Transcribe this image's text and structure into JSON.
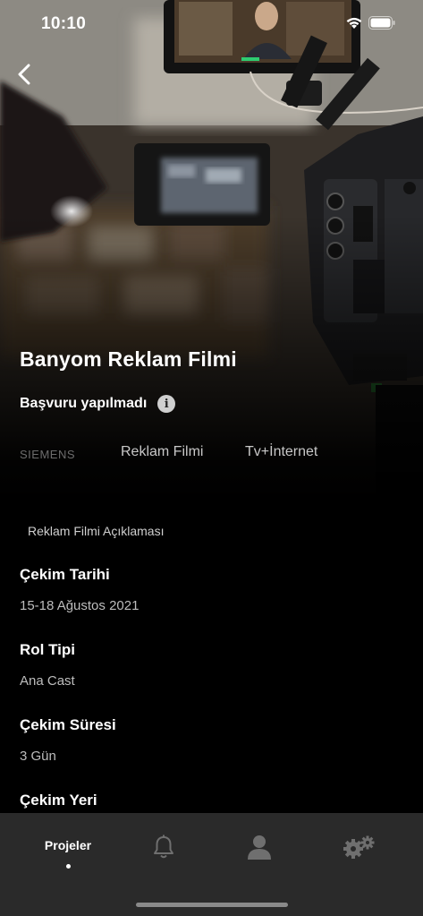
{
  "status_bar": {
    "time": "10:10"
  },
  "header": {
    "back_icon": "chevron-left-icon"
  },
  "project": {
    "title": "Banyom Reklam Filmi",
    "application_status": "Başvuru yapılmadı",
    "tags": {
      "brand": "SIEMENS",
      "type": "Reklam Filmi",
      "media": "Tv+İnternet"
    }
  },
  "details": {
    "description_label": "Reklam Filmi Açıklaması",
    "fields": [
      {
        "label": "Çekim Tarihi",
        "value": "15-18 Ağustos 2021"
      },
      {
        "label": "Rol Tipi",
        "value": "Ana Cast"
      },
      {
        "label": "Çekim Süresi",
        "value": "3 Gün"
      },
      {
        "label": "Çekim Yeri",
        "value": ""
      }
    ]
  },
  "tab_bar": {
    "items": [
      {
        "label": "Projeler",
        "icon": "projects",
        "active": true
      },
      {
        "label": "",
        "icon": "bell-icon",
        "active": false
      },
      {
        "label": "",
        "icon": "user-icon",
        "active": false
      },
      {
        "label": "",
        "icon": "settings-gears-icon",
        "active": false
      }
    ]
  },
  "colors": {
    "background": "#000000",
    "tab_bar": "#2a2a2a",
    "secondary_text": "#bdbdbd"
  }
}
